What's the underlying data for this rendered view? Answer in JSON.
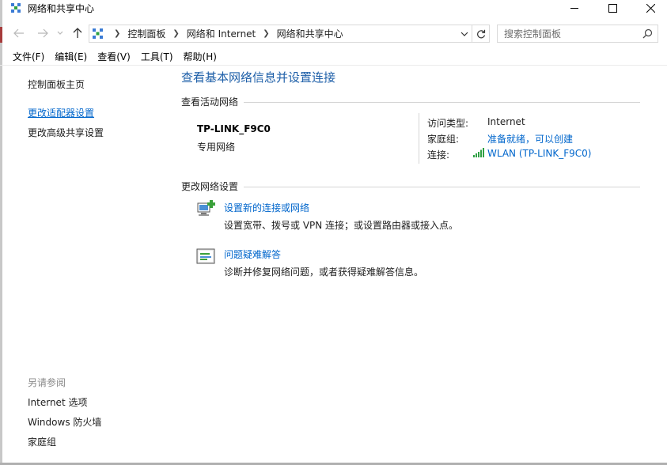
{
  "window": {
    "title": "网络和共享中心"
  },
  "navigation": {
    "breadcrumbs": [
      "控制面板",
      "网络和 Internet",
      "网络和共享中心"
    ],
    "search_placeholder": "搜索控制面板"
  },
  "menu": [
    "文件(F)",
    "编辑(E)",
    "查看(V)",
    "工具(T)",
    "帮助(H)"
  ],
  "sidebar": {
    "home": "控制面板主页",
    "links": [
      "更改适配器设置",
      "更改高级共享设置"
    ],
    "see_also_heading": "另请参阅",
    "see_also": [
      "Internet 选项",
      "Windows 防火墙",
      "家庭组"
    ]
  },
  "main": {
    "title": "查看基本网络信息并设置连接",
    "active_networks_heading": "查看活动网络",
    "network": {
      "name": "TP-LINK_F9C0",
      "type": "专用网络",
      "access_type_label": "访问类型:",
      "access_type_value": "Internet",
      "homegroup_label": "家庭组:",
      "homegroup_value": "准备就绪，可以创建",
      "connection_label": "连接:",
      "connection_value": "WLAN (TP-LINK_F9C0)"
    },
    "change_settings_heading": "更改网络设置",
    "tasks": [
      {
        "link": "设置新的连接或网络",
        "desc": "设置宽带、拨号或 VPN 连接；或设置路由器或接入点。"
      },
      {
        "link": "问题疑难解答",
        "desc": "诊断并修复网络问题，或者获得疑难解答信息。"
      }
    ]
  },
  "colors": {
    "link": "#0066cc",
    "title": "#1e5fa8",
    "wifi": "#2ea043"
  }
}
